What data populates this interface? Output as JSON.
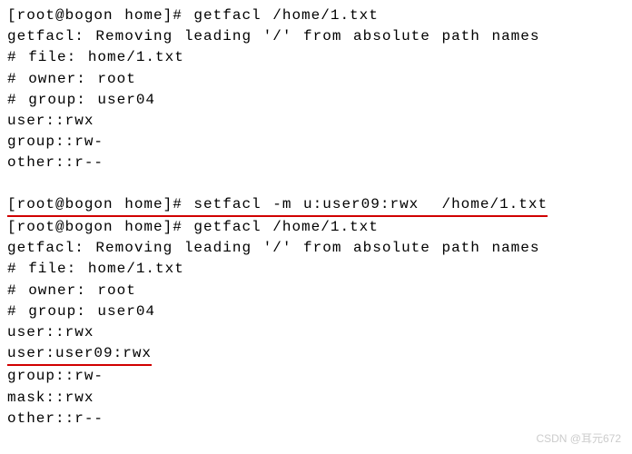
{
  "block1": {
    "prompt": "[root@bogon home]# getfacl /home/1.txt",
    "warning": "getfacl: Removing leading '/' from absolute path names",
    "file": "# file: home/1.txt",
    "owner": "# owner: root",
    "group": "# group: user04",
    "user_perm": "user::rwx",
    "group_perm": "group::rw-",
    "other_perm": "other::r--"
  },
  "block2": {
    "setfacl_cmd": "[root@bogon home]# setfacl -m u:user09:rwx  /home/1.txt",
    "getfacl_cmd": "[root@bogon home]# getfacl /home/1.txt",
    "warning": "getfacl: Removing leading '/' from absolute path names",
    "file": "# file: home/1.txt",
    "owner": "# owner: root",
    "group": "# group: user04",
    "user_perm": "user::rwx",
    "user09_perm": "user:user09:rwx",
    "group_perm": "group::rw-",
    "mask_perm": "mask::rwx",
    "other_perm": "other::r--"
  },
  "watermark": "CSDN @耳元672"
}
